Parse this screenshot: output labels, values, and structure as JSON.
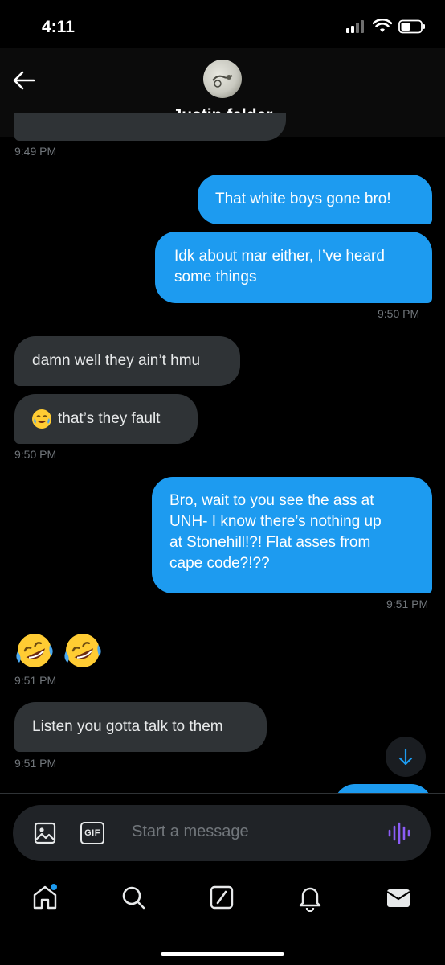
{
  "status_bar": {
    "time": "4:11"
  },
  "header": {
    "name": "Justin felder"
  },
  "messages": [
    {
      "dir": "in",
      "time": "9:49 PM"
    },
    {
      "dir": "out",
      "text": "That white boys gone bro!"
    },
    {
      "dir": "out",
      "lines": [
        "Idk about mar either, I’ve heard",
        "some things"
      ],
      "time": "9:50 PM"
    },
    {
      "dir": "in",
      "text": "damn well they ain’t hmu"
    },
    {
      "dir": "in",
      "text": "that’s they fault",
      "emoji": "face-with-tears-of-joy",
      "time": "9:50 PM"
    },
    {
      "dir": "out",
      "lines": [
        "Bro, wait to you see the ass at",
        "UNH- I know there’s nothing up",
        "at Stonehill!?! Flat asses from",
        "cape code?!??"
      ],
      "time": "9:51 PM"
    },
    {
      "dir": "in",
      "emoji_only": [
        "rolling-on-the-floor-laughing",
        "rolling-on-the-floor-laughing"
      ],
      "time": "9:51 PM"
    },
    {
      "dir": "in",
      "text": "Listen you gotta talk to them",
      "time": "9:51 PM"
    }
  ],
  "composer": {
    "placeholder": "Start a message",
    "gif_label": "GIF"
  },
  "tabs": [
    "home",
    "search",
    "grok",
    "notifications",
    "messages"
  ],
  "colors": {
    "accent": "#1d9bf0",
    "incoming_bubble": "#2f3336",
    "voice_purple": "#8b5cf6"
  }
}
